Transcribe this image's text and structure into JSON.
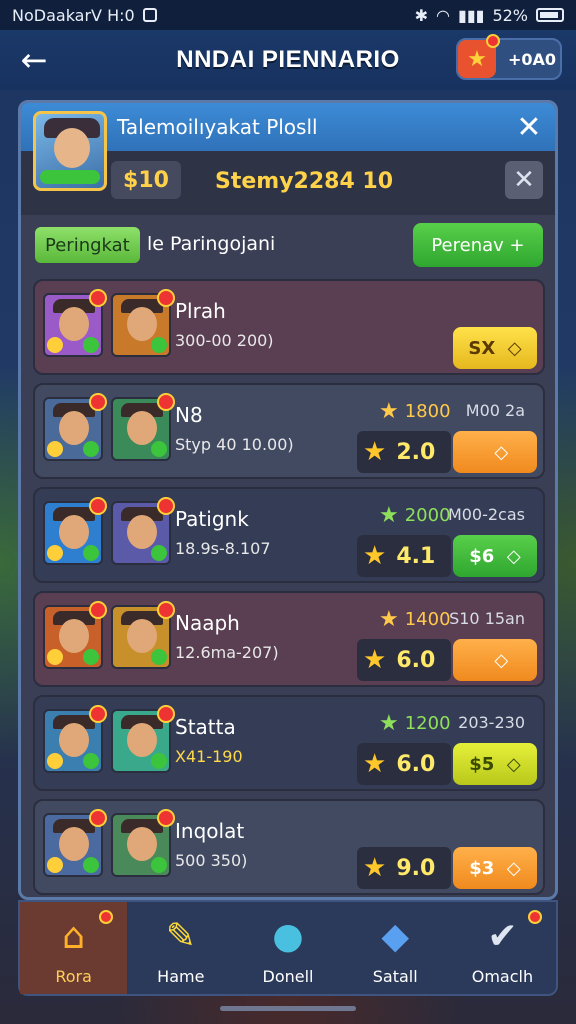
{
  "status_bar": {
    "left_text": "NoDaakarV H:0",
    "battery_text": "52%"
  },
  "header": {
    "title": "NNDAI PIENNARIO",
    "badge_value": "+0A0"
  },
  "panel": {
    "title": "Talemoilıyakat Plosll",
    "coins": "$10",
    "subtitle": "Stemy2284 10",
    "tab_active_label": "Peringkat",
    "tab_label": "le Paringojani",
    "tab_button_label": "Perenav"
  },
  "rows": [
    {
      "name": "Plrah",
      "sub": "300-00 200)",
      "stat": "",
      "meta": "",
      "score": "",
      "action": "SX",
      "action_style": "yellow",
      "color": "#5a3e52"
    },
    {
      "name": "N8",
      "sub": "Styp 40 10.00)",
      "stat": "1800",
      "meta": "M00 2a",
      "score": "2.0",
      "action": "",
      "action_style": "orange",
      "color": "#424a62"
    },
    {
      "name": "Patignk",
      "sub": "18.9s-8.107",
      "stat": "2000",
      "meta": "M00-2cas",
      "score": "4.1",
      "action": "$6",
      "action_style": "green",
      "color": "#353d56"
    },
    {
      "name": "Naaph",
      "sub": "12.6ma-207)",
      "stat": "1400",
      "meta": "S10 15an",
      "score": "6.0",
      "action": "",
      "action_style": "orange",
      "color": "#5a3e52"
    },
    {
      "name": "Statta",
      "sub": "X41-190",
      "stat": "1200",
      "meta": "203-230",
      "score": "6.0",
      "action": "$5",
      "action_style": "lime",
      "color": "#353d56"
    },
    {
      "name": "Inqolat",
      "sub": "500 350)",
      "stat": "",
      "meta": "",
      "score": "9.0",
      "action": "$3",
      "action_style": "orange",
      "color": "#424a62"
    }
  ],
  "nav": [
    {
      "label": "Rora",
      "icon": "home-icon"
    },
    {
      "label": "Hame",
      "icon": "chat-icon"
    },
    {
      "label": "Donell",
      "icon": "bird-icon"
    },
    {
      "label": "Satall",
      "icon": "cat-icon"
    },
    {
      "label": "Omaclh",
      "icon": "check-icon"
    }
  ]
}
